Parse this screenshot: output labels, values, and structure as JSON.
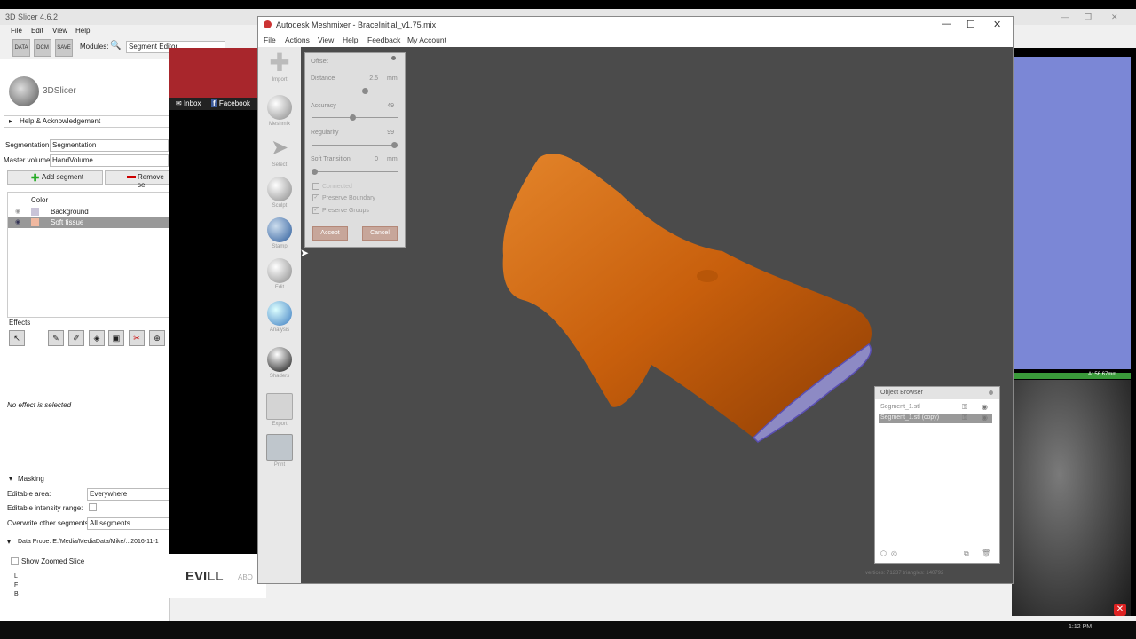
{
  "slicer": {
    "title": "3D Slicer 4.6.2",
    "menu": [
      "File",
      "Edit",
      "View",
      "Help"
    ],
    "toolbar": {
      "data_label": "DATA",
      "dcm_label": "DCM",
      "save_label": "SAVE",
      "modules_label": "Modules:",
      "module_selected": "Segment Editor"
    },
    "logo_text": "3DSlicer",
    "help_ack": "Help & Acknowledgement",
    "segmentation_label": "Segmentation:",
    "segmentation_value": "Segmentation",
    "master_volume_label": "Master volume:",
    "master_volume_value": "HandVolume",
    "add_segment": "Add segment",
    "remove_segment": "Remove se",
    "table": {
      "col_color": "Color",
      "rows": [
        "Background",
        "Soft tissue"
      ]
    },
    "effects_label": "Effects",
    "no_effect": "No effect is selected",
    "masking_label": "Masking",
    "editable_area_label": "Editable area:",
    "editable_area_value": "Everywhere",
    "editable_intensity_label": "Editable intensity range:",
    "overwrite_label": "Overwrite other segments:",
    "overwrite_value": "All segments",
    "data_probe": "Data Probe: E:/Media/MediaData/Mike/...2016-11-1",
    "show_zoomed": "Show Zoomed Slice",
    "probe_rows": [
      "L",
      "F",
      "B"
    ],
    "view_readout": "A: 56.67mm"
  },
  "browser": {
    "inbox": "Inbox",
    "facebook": "Facebook",
    "evill": "EVILL",
    "about": "ABO"
  },
  "meshmixer": {
    "title": "Autodesk Meshmixer - BraceInitial_v1.75.mix",
    "menu": [
      "File",
      "Actions",
      "View",
      "Help",
      "Feedback",
      "My Account"
    ],
    "tools": [
      "Import",
      "Meshmix",
      "Select",
      "Sculpt",
      "Stamp",
      "Edit",
      "Analysis",
      "Shaders",
      "Export",
      "Print"
    ],
    "offset_panel": {
      "title": "Offset",
      "distance_label": "Distance",
      "distance_value": "2.5",
      "distance_unit": "mm",
      "distance_fraction": 0.62,
      "accuracy_label": "Accuracy",
      "accuracy_value": "49",
      "accuracy_fraction": 0.47,
      "regularity_label": "Regularity",
      "regularity_value": "99",
      "regularity_fraction": 0.98,
      "soft_label": "Soft Transition",
      "soft_value": "0",
      "soft_unit": "mm",
      "soft_fraction": 0.0,
      "connected": "Connected",
      "preserve_boundary": "Preserve Boundary",
      "preserve_groups": "Preserve Groups",
      "accept": "Accept",
      "cancel": "Cancel"
    },
    "object_browser": {
      "title": "Object Browser",
      "items": [
        "Segment_1.stl",
        "Segment_1.stl (copy)"
      ]
    },
    "status": "vertices: 71237 triangles: 140792"
  },
  "taskbar": {
    "time": "1:12 PM"
  },
  "colors": {
    "mesh": "#d46a12",
    "viewport": "#4b4b4b",
    "accent_red": "#a8262c"
  }
}
